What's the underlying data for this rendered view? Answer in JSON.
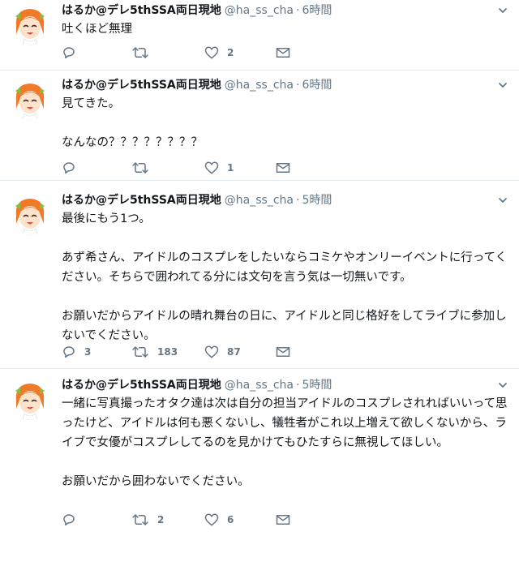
{
  "tweets": [
    {
      "name": "はるか@デレ5thSSA両日現地",
      "handle": "@ha_ss_cha",
      "dot": "·",
      "time": "6時間",
      "paragraphs": [
        "吐くほど無理"
      ],
      "replies": "",
      "retweets": "",
      "likes": "2"
    },
    {
      "name": "はるか@デレ5thSSA両日現地",
      "handle": "@ha_ss_cha",
      "dot": "·",
      "time": "6時間",
      "paragraphs": [
        "見てきた。",
        "なんなの？？？？？？？？"
      ],
      "replies": "",
      "retweets": "",
      "likes": "1"
    },
    {
      "name": "はるか@デレ5thSSA両日現地",
      "handle": "@ha_ss_cha",
      "dot": "·",
      "time": "5時間",
      "paragraphs": [
        "最後にもう1つ。",
        "あず希さん、アイドルのコスプレをしたいならコミケやオンリーイベントに行ってください。そちらで囲われてる分には文句を言う気は一切無いです。",
        "お願いだからアイドルの晴れ舞台の日に、アイドルと同じ格好をしてライブに参加しないでください。"
      ],
      "replies": "3",
      "retweets": "183",
      "likes": "87"
    },
    {
      "name": "はるか@デレ5thSSA両日現地",
      "handle": "@ha_ss_cha",
      "dot": "·",
      "time": "5時間",
      "paragraphs": [
        "一緒に写真撮ったオタク達は次は自分の担当アイドルのコスプレされればいいって思ったけど、アイドルは何も悪くないし、犠牲者がこれ以上増えて欲しくないから、ライブで女優がコスプレしてるのを見かけてもひたすらに無視してほしい。",
        "お願いだから囲わないでください。"
      ],
      "replies": "",
      "retweets": "2",
      "likes": "6"
    }
  ],
  "icons": {
    "reply": "reply-icon",
    "retweet": "retweet-icon",
    "like": "heart-icon",
    "dm": "envelope-icon",
    "caret": "chevron-down-icon",
    "avatar": "avatar-orange-hair-girl"
  },
  "colors": {
    "text": "#14171a",
    "secondary": "#657786",
    "border": "#e6ecf0",
    "avatar_hair": "#f07a28",
    "avatar_ribbon": "#7fc241"
  }
}
